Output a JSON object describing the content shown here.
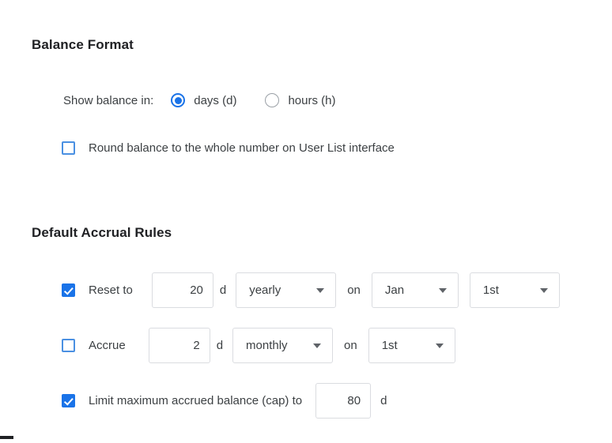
{
  "sections": {
    "balance_format": {
      "title": "Balance Format",
      "show_balance_label": "Show balance in:",
      "unit_options": [
        {
          "label": "days (d)",
          "selected": true
        },
        {
          "label": "hours (h)",
          "selected": false
        }
      ],
      "round_balance": {
        "label": "Round balance to the whole number on User List interface",
        "checked": false
      }
    },
    "default_accrual_rules": {
      "title": "Default Accrual Rules",
      "reset_rule": {
        "label": "Reset to",
        "checked": true,
        "amount": "20",
        "unit": "d",
        "frequency": "yearly",
        "conjunction": "on",
        "month": "Jan",
        "day": "1st"
      },
      "accrue_rule": {
        "label": "Accrue",
        "checked": false,
        "amount": "2",
        "unit": "d",
        "frequency": "monthly",
        "conjunction": "on",
        "day": "1st"
      },
      "cap_rule": {
        "label": "Limit maximum accrued balance (cap) to",
        "checked": true,
        "amount": "80",
        "unit": "d"
      }
    }
  },
  "colors": {
    "accent": "#1a73e8",
    "text": "#3c4043",
    "heading": "#202124",
    "border": "#dadce0",
    "background": "#ffffff"
  }
}
